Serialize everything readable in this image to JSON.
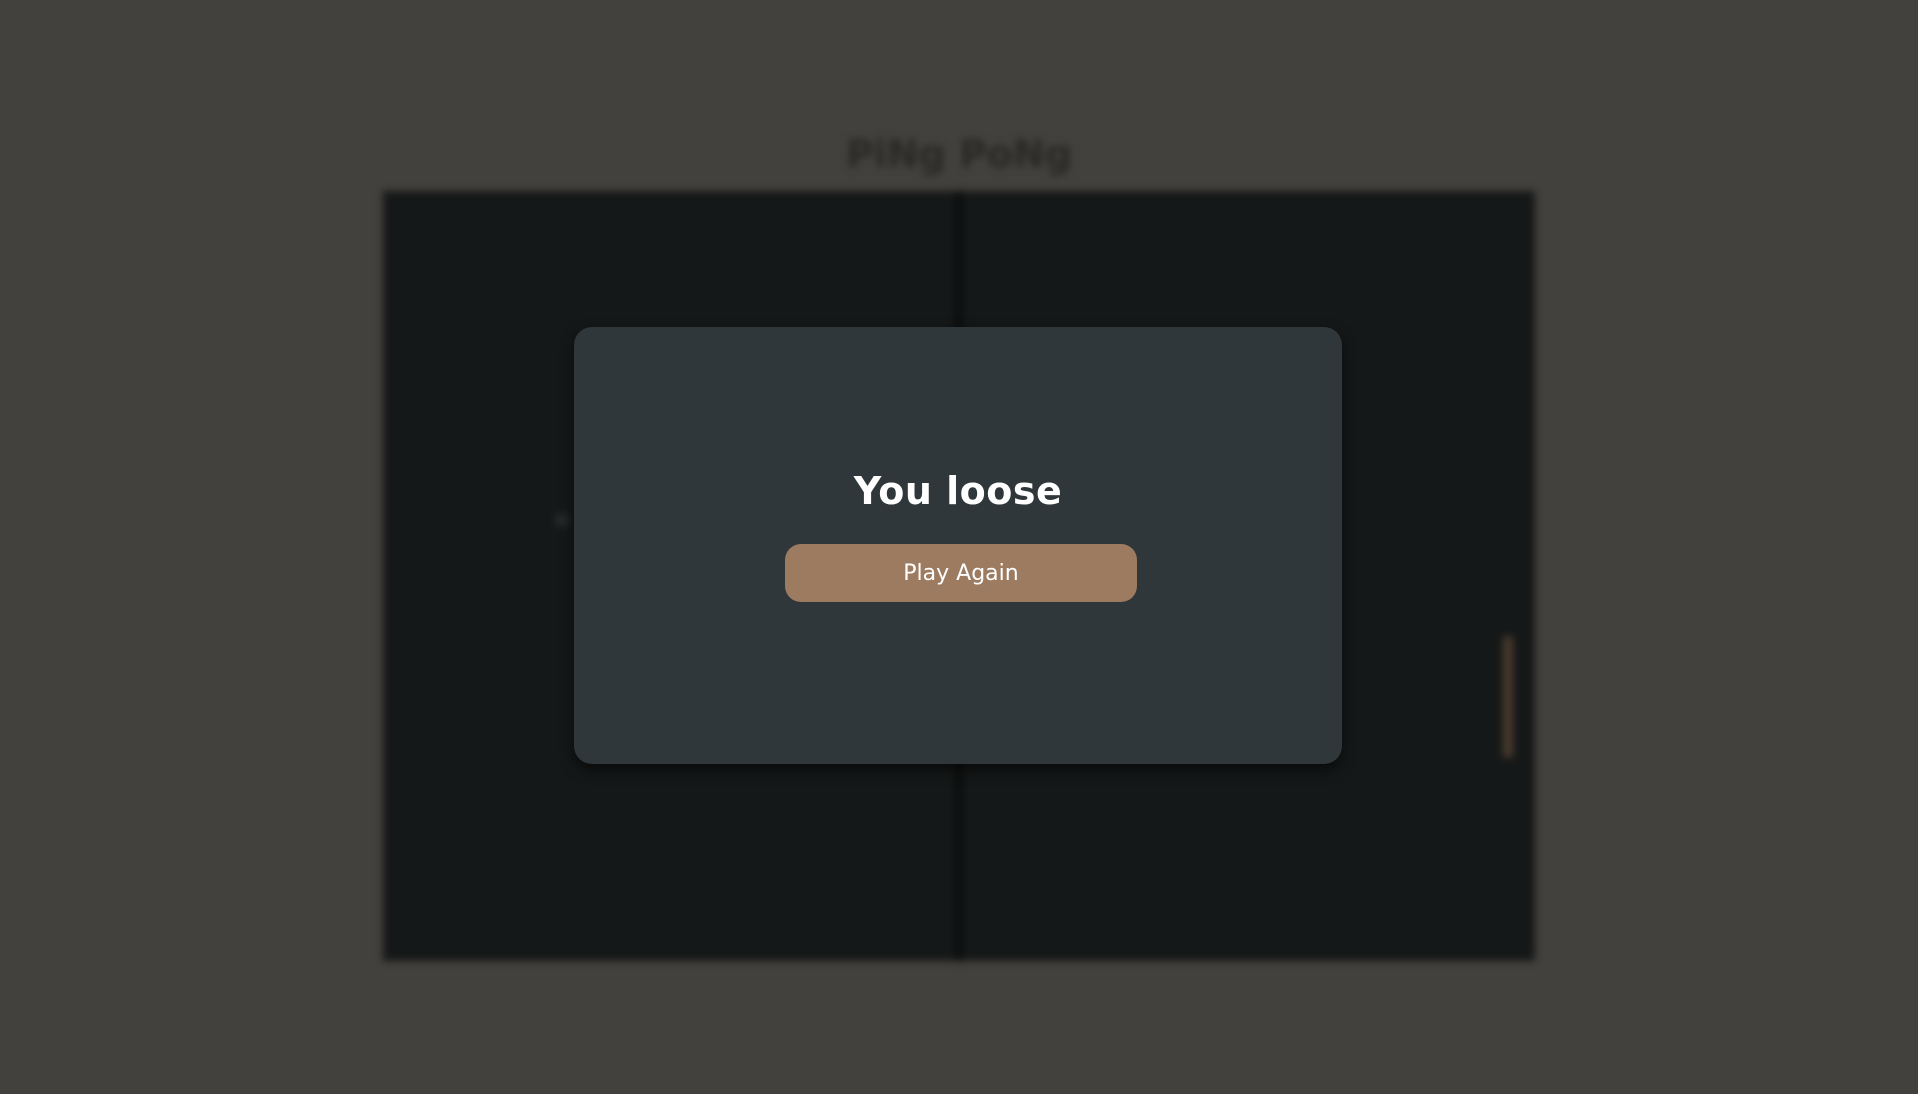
{
  "game": {
    "title": "PiNg PoNg"
  },
  "modal": {
    "result": "You loose",
    "play_again_label": "Play Again"
  },
  "colors": {
    "page_background": "#43413d",
    "board_background": "#151818",
    "modal_background": "#2f373b",
    "button_background": "#9c7b61",
    "text": "#ffffff"
  }
}
